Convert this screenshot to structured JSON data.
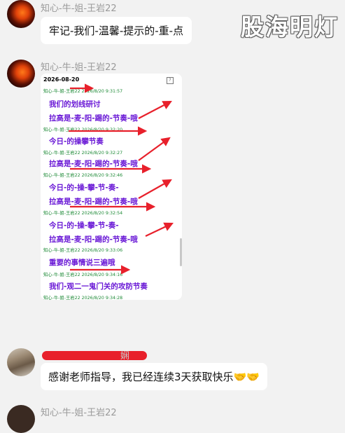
{
  "watermark": "股海明灯",
  "messages": [
    {
      "sender": "知心-牛-姐-王岩22",
      "text": "牢记-我们-温馨-提示的-重-点"
    },
    {
      "sender": "知心-牛-姐-王岩22",
      "image": {
        "date": "2026-08-20",
        "help_icon": "help-icon",
        "entries": [
          {
            "meta": "知心-牛-姐-王岩22 2026/8/20 9:31:57",
            "lines": [
              "我们的划线研讨",
              "拉高是-麦-阳-踢的-节奏-哦"
            ]
          },
          {
            "meta": "知心-牛-姐-王岩22 2026/8/20 9:32:20",
            "lines": [
              "今日-的操攀节奏"
            ]
          },
          {
            "meta": "知心-牛-姐-王岩22 2026/8/20 9:32:27",
            "lines": [
              "拉高是-麦-阳-踢的-节奏-哦"
            ]
          },
          {
            "meta": "知心-牛-姐-王岩22 2026/8/20 9:32:46",
            "lines": [
              "今日-的-操-攀-节-奏-",
              "拉高是-麦-阳-踢的-节奏-哦"
            ]
          },
          {
            "meta": "知心-牛-姐-王岩22 2026/8/20 9:32:54",
            "lines": [
              "今日-的-操-攀-节-奏-",
              "拉高是-麦-阳-踢的-节奏-哦"
            ]
          },
          {
            "meta": "知心-牛-姐-王岩22 2026/8/20 9:33:06",
            "lines": [
              "重要的事情说三遍哦"
            ]
          },
          {
            "meta": "知心-牛-姐-王岩22 2026/8/20 9:34:16",
            "lines": [
              "我们-观二一鬼门关的攻防节奏"
            ]
          },
          {
            "meta": "知心-牛-姐-王岩22 2026/8/20 9:34:28",
            "lines": []
          }
        ]
      }
    },
    {
      "sender": "娴",
      "text": "感谢老师指导，我已经连续3天获取快乐",
      "emoji": "🤝🤝"
    },
    {
      "sender": "知心-牛-姐-王岩22"
    }
  ],
  "colors": {
    "background": "#f2f2f2",
    "bubble": "#ffffff",
    "annotation_red": "#e8202b",
    "message_purple": "#6a19d6",
    "meta_green": "#1d8a36"
  }
}
